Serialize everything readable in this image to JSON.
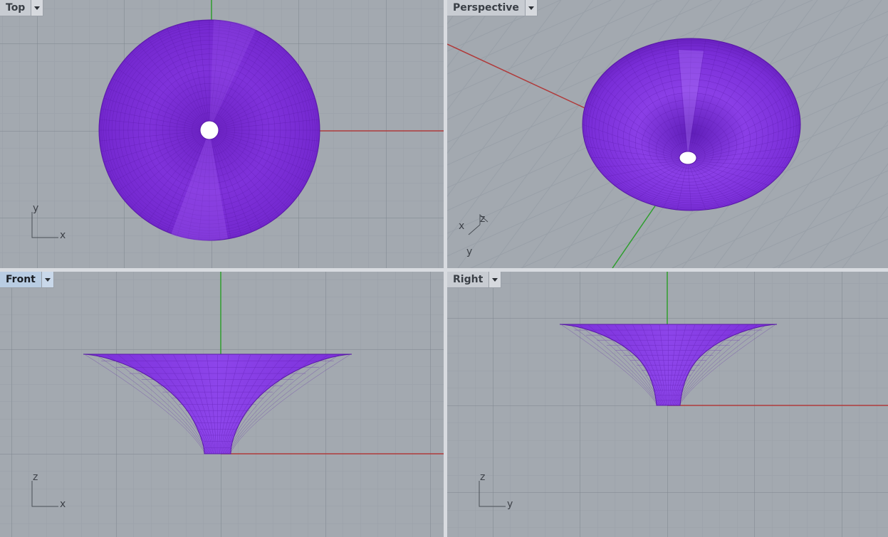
{
  "viewports": {
    "top": {
      "title": "Top",
      "active": false,
      "axis_x": "x",
      "axis_y": "y"
    },
    "perspective": {
      "title": "Perspective",
      "active": false,
      "axis_x": "x",
      "axis_y": "y",
      "axis_z": "z"
    },
    "front": {
      "title": "Front",
      "active": true,
      "axis_x": "x",
      "axis_z": "z"
    },
    "right": {
      "title": "Right",
      "active": false,
      "axis_y": "y",
      "axis_z": "z"
    }
  },
  "colors": {
    "viewport_background": "#a3a9b0",
    "grid_minor": "#99a0a8",
    "grid_major": "#7e858e",
    "x_axis": "#b03a3a",
    "y_axis": "#2e9e2e",
    "surface": "#7b2fd6",
    "surface_highlight": "#a05cf0",
    "surface_wire": "#5a1aa8",
    "active_tab": "#b9cde3"
  }
}
